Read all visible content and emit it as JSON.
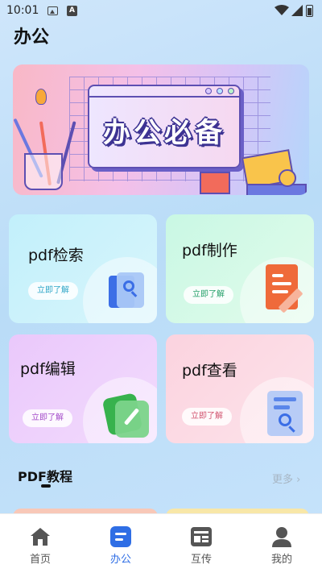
{
  "status_bar": {
    "time": "10:01",
    "notif_icon_letter": "A"
  },
  "page": {
    "title": "办公"
  },
  "banner": {
    "text": "办公必备"
  },
  "cards": [
    {
      "title": "pdf检索",
      "button": "立即了解",
      "icon": "document-search-icon",
      "accent": "#2ea6c7"
    },
    {
      "title": "pdf制作",
      "button": "立即了解",
      "icon": "document-edit-icon",
      "accent": "#25a06a"
    },
    {
      "title": "pdf编辑",
      "button": "立即了解",
      "icon": "edit-icon",
      "accent": "#a44cc9"
    },
    {
      "title": "pdf查看",
      "button": "立即了解",
      "icon": "document-view-icon",
      "accent": "#d1536f"
    }
  ],
  "section": {
    "title": "PDF教程",
    "more": "更多 ›"
  },
  "tabbar": {
    "active_color": "#2f6ee5",
    "items": [
      {
        "label": "首页",
        "icon": "home-icon",
        "active": false
      },
      {
        "label": "办公",
        "icon": "document-icon",
        "active": true
      },
      {
        "label": "互传",
        "icon": "transfer-icon",
        "active": false
      },
      {
        "label": "我的",
        "icon": "user-icon",
        "active": false
      }
    ]
  }
}
